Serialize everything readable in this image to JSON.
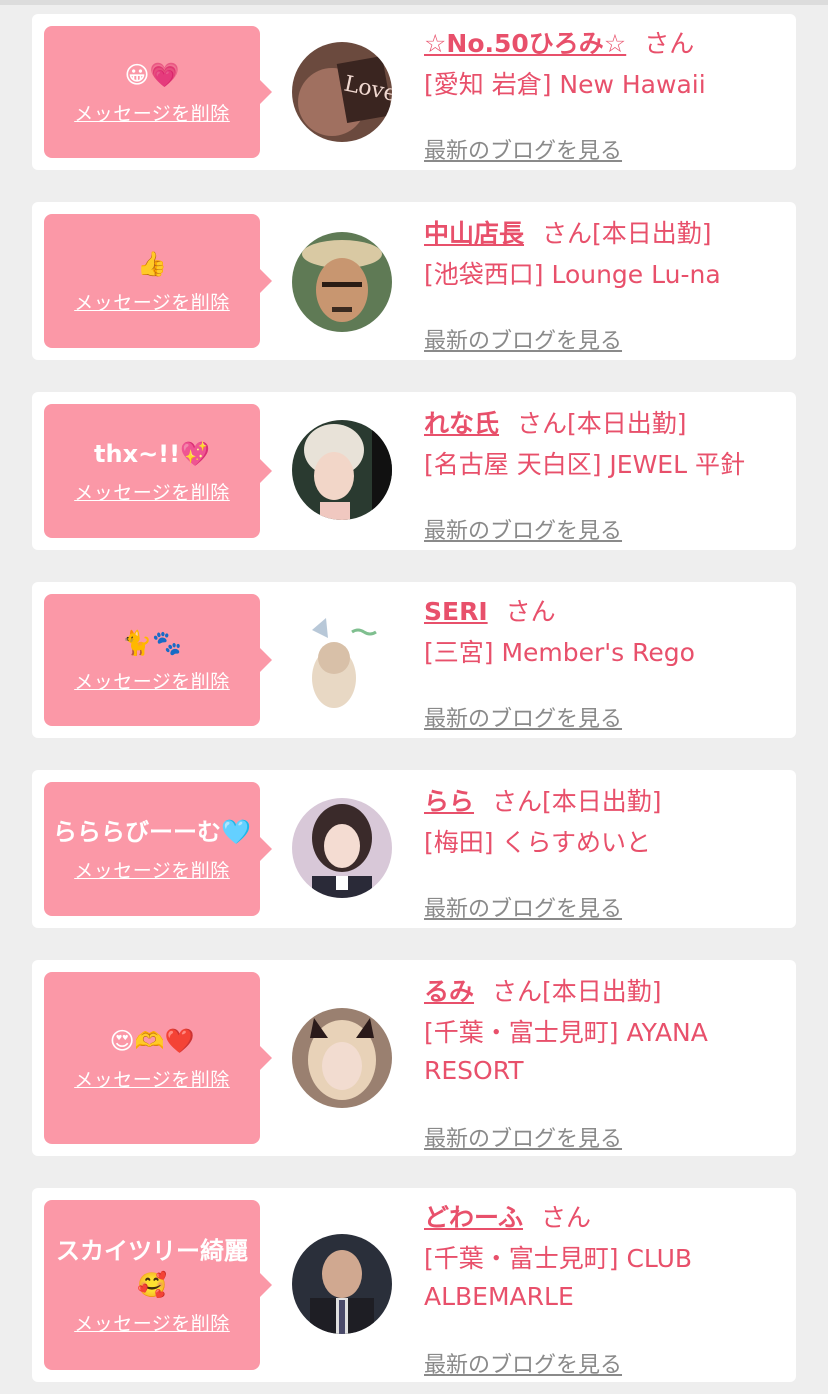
{
  "delete_label": "メッセージを削除",
  "blog_label": "最新のブログを見る",
  "colors": {
    "accent": "#e8506b",
    "bubble": "#fb98a7",
    "background": "#eeeeee"
  },
  "items": [
    {
      "message": "😀💗",
      "name": "☆No.50ひろみ☆",
      "suffix": "さん",
      "shop": "[愛知 岩倉] New Hawaii"
    },
    {
      "message": "👍",
      "name": "中山店長",
      "suffix": "さん[本日出勤]",
      "shop": "[池袋西口] Lounge Lu-na"
    },
    {
      "message": "thx~!!💖",
      "name": "れな氏",
      "suffix": "さん[本日出勤]",
      "shop": "[名古屋 天白区] JEWEL 平針"
    },
    {
      "message": "🐈🐾",
      "name": "SERI",
      "suffix": "さん",
      "shop": "[三宮] Member's Rego"
    },
    {
      "message": "らららびーーむ🩵",
      "name": "らら",
      "suffix": "さん[本日出勤]",
      "shop": "[梅田] くらすめいと"
    },
    {
      "message": "😍🫶❤️",
      "name": "るみ",
      "suffix": "さん[本日出勤]",
      "shop": "[千葉・富士見町] AYANA RESORT"
    },
    {
      "message": "スカイツリー綺麗🥰",
      "name": "どわーふ",
      "suffix": "さん",
      "shop": "[千葉・富士見町] CLUB ALBEMARLE"
    }
  ]
}
